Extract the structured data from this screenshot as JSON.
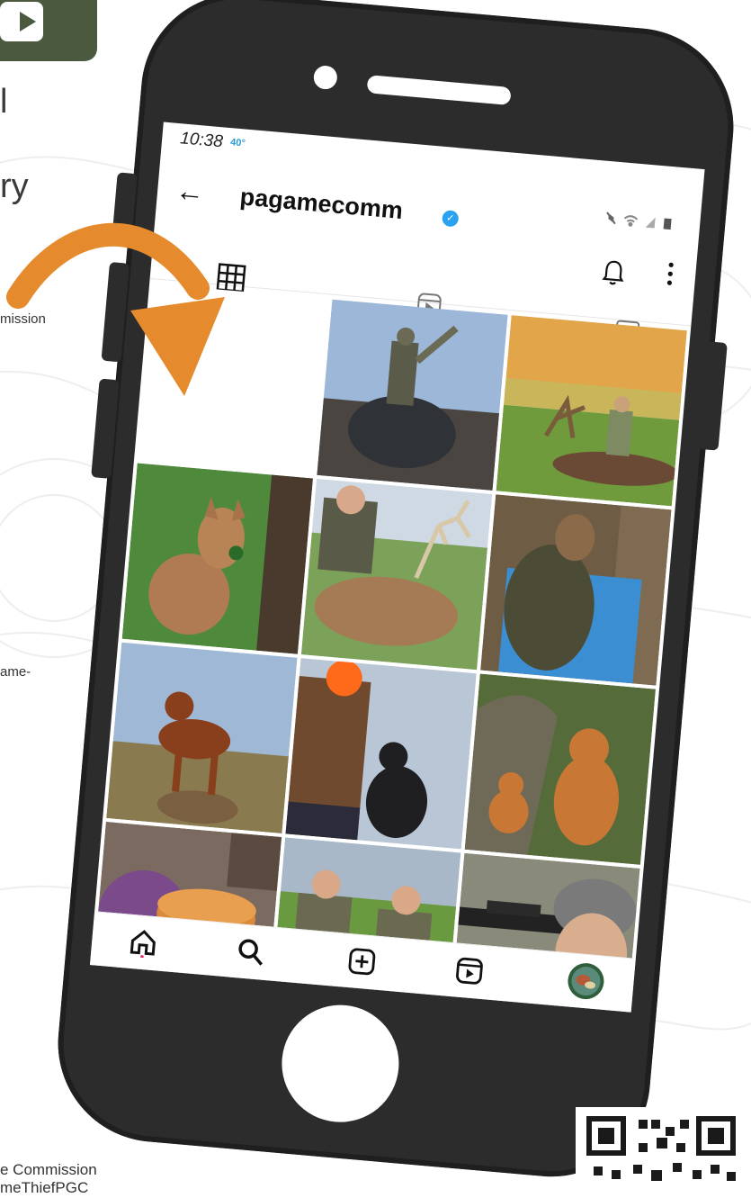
{
  "page": {
    "left_text_lines": [
      "l",
      "ry",
      "mission",
      "ame-",
      "e Commission",
      "meThiefPGC"
    ]
  },
  "status": {
    "time": "10:38",
    "temp": "40°"
  },
  "profile": {
    "handle": "pagamecomm"
  },
  "colors": {
    "arrow": "#e68a2e",
    "verified": "#2aa1f1",
    "phone": "#2c2c2c",
    "yt_tile": "#4b5a3f"
  },
  "posts": [
    {
      "subject": "empty",
      "color": "#ffffff"
    },
    {
      "subject": "turkey hunter",
      "color": "#4a5a6a"
    },
    {
      "subject": "elk at sunset",
      "color": "#8a7a40"
    },
    {
      "subject": "fawn",
      "color": "#4a7a3a"
    },
    {
      "subject": "whitetail buck",
      "color": "#7a8a50"
    },
    {
      "subject": "hunter backpack",
      "color": "#3a6f9f"
    },
    {
      "subject": "bird dog",
      "color": "#7a6a50"
    },
    {
      "subject": "hunter with dog snow",
      "color": "#a7b5c8"
    },
    {
      "subject": "fox kits",
      "color": "#8a6a3a"
    },
    {
      "subject": "craft decoy",
      "color": "#6a4a4a"
    },
    {
      "subject": "two hunters",
      "color": "#5a7a3a"
    },
    {
      "subject": "rifle hunter",
      "color": "#7a7a7a"
    }
  ]
}
